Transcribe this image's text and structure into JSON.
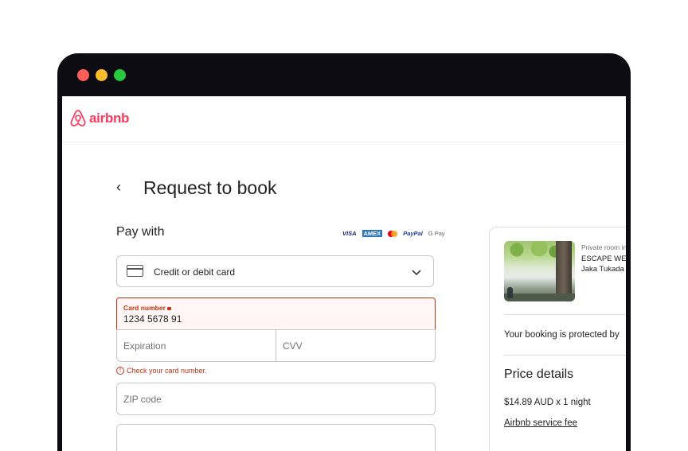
{
  "brand": {
    "name": "airbnb",
    "color": "#ff385c"
  },
  "page": {
    "title": "Request to book",
    "back_icon": "chevron-left-icon"
  },
  "payment": {
    "heading": "Pay with",
    "card_brands": [
      "VISA",
      "AMEX",
      "PayPal",
      "G Pay"
    ],
    "method_select": {
      "value": "Credit or debit card",
      "icon": "credit-card-icon"
    },
    "card_number": {
      "label": "Card number",
      "value": "1234 5678 91",
      "state": "error"
    },
    "expiration": {
      "placeholder": "Expiration"
    },
    "cvv": {
      "placeholder": "CVV"
    },
    "error_message": "Check your card number.",
    "zip": {
      "placeholder": "ZIP code"
    }
  },
  "summary": {
    "room_type": "Private room in",
    "room_name": "ESCAPE WES",
    "host": "Jaka Tukada",
    "protection": "Your booking is protected by",
    "price_title": "Price details",
    "price_line": "$14.89 AUD x 1 night",
    "service_fee": "Airbnb service fee"
  },
  "colors": {
    "error": "#c13515",
    "error_bg": "#fff6f5",
    "window": "#0c0c12"
  }
}
